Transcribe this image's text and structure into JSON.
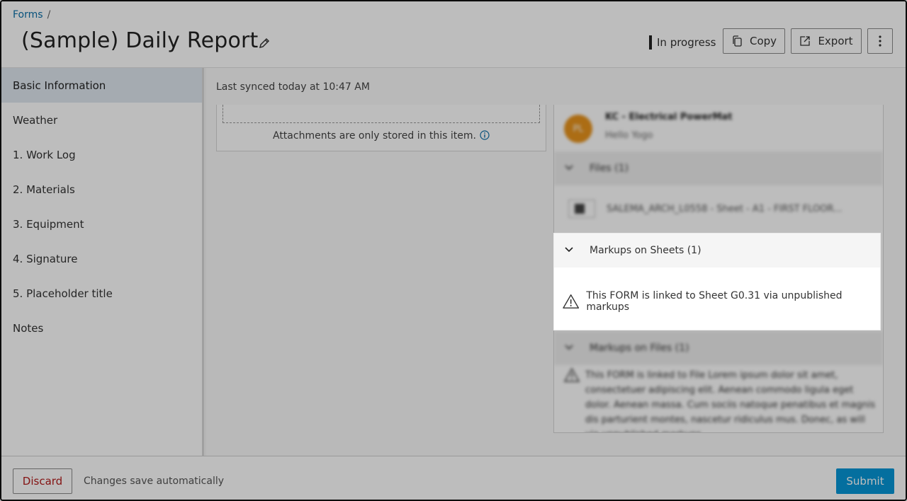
{
  "breadcrumb": {
    "root": "Forms",
    "separator": "/"
  },
  "header": {
    "title": "(Sample) Daily Report",
    "status": "In progress",
    "copy_label": "Copy",
    "export_label": "Export"
  },
  "sidebar": {
    "items": [
      {
        "label": "Basic Information",
        "active": true
      },
      {
        "label": "Weather"
      },
      {
        "label": "1. Work Log"
      },
      {
        "label": "2. Materials"
      },
      {
        "label": "3. Equipment"
      },
      {
        "label": "4. Signature"
      },
      {
        "label": "5. Placeholder title"
      },
      {
        "label": "Notes"
      }
    ]
  },
  "main": {
    "sync_text": "Last synced today at 10:47 AM",
    "attachments_note": "Attachments are only stored in this item."
  },
  "right_panel": {
    "assignee_name": "KC - Electrical PowerMat",
    "assignee_initials": "PL",
    "assignee_company": "Hello Yogo",
    "files_header": "Files (1)",
    "file_name": "SALEMA_ARCH_L0558 - Sheet - A1 - FIRST FLOOR...",
    "markups_sheets_header": "Markups on Sheets (1)",
    "markups_sheets_message": "This FORM is linked to Sheet G0.31 via unpublished markups",
    "markups_files_header": "Markups on Files (1)",
    "markups_files_message": "This FORM is linked to File Lorem ipsum dolor sit amet, consectetuer adipiscing elit. Aenean commodo ligula eget dolor. Aenean massa. Cum sociis natoque penatibus et magnis dis parturient montes, nascetur ridiculus mus. Donec, as will via unpublished markups."
  },
  "footer": {
    "discard_label": "Discard",
    "autosave_text": "Changes save automatically",
    "submit_label": "Submit"
  },
  "colors": {
    "link": "#0b6fa8",
    "submit": "#0696d7",
    "discard_text": "#b31b1b",
    "avatar": "#e8931c",
    "active_nav": "#dfe7ef"
  }
}
